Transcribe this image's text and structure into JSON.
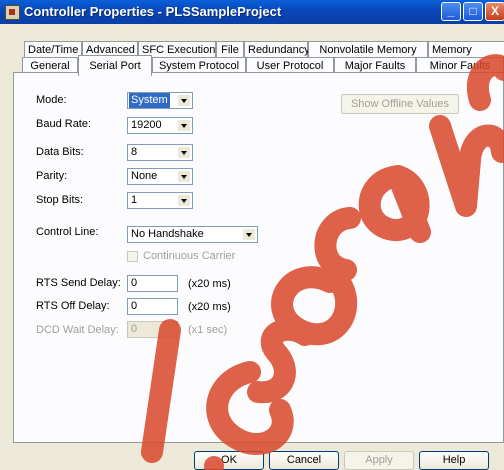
{
  "window": {
    "title": "Controller Properties - PLSSampleProject",
    "controls": {
      "minimize": "_",
      "maximize": "□",
      "close": "X"
    }
  },
  "tabs": {
    "row1": [
      "Date/Time",
      "Advanced",
      "SFC Execution",
      "File",
      "Redundancy",
      "Nonvolatile Memory",
      "Memory"
    ],
    "row2": [
      "General",
      "Serial Port",
      "System Protocol",
      "User Protocol",
      "Major Faults",
      "Minor Faults"
    ],
    "active": "Serial Port"
  },
  "serial_port": {
    "mode": {
      "label": "Mode:",
      "value": "System"
    },
    "baud_rate": {
      "label": "Baud Rate:",
      "value": "19200"
    },
    "data_bits": {
      "label": "Data Bits:",
      "value": "8"
    },
    "parity": {
      "label": "Parity:",
      "value": "None"
    },
    "stop_bits": {
      "label": "Stop Bits:",
      "value": "1"
    },
    "control_line": {
      "label": "Control Line:",
      "value": "No Handshake"
    },
    "continuous_carrier": {
      "label": "Continuous Carrier",
      "checked": false,
      "enabled": false
    },
    "rts_send_delay": {
      "label": "RTS Send Delay:",
      "value": "0",
      "unit": "(x20 ms)"
    },
    "rts_off_delay": {
      "label": "RTS Off Delay:",
      "value": "0",
      "unit": "(x20 ms)"
    },
    "dcd_wait_delay": {
      "label": "DCD Wait Delay:",
      "value": "0",
      "unit": "(x1 sec)",
      "enabled": false
    },
    "show_offline_values": "Show Offline Values"
  },
  "buttons": {
    "ok": "OK",
    "cancel": "Cancel",
    "apply": "Apply",
    "help": "Help"
  },
  "colors": {
    "title_bar": "#0a4fc4",
    "dialog_bg": "#ece9d8",
    "panel_bg": "#fcfcfe",
    "selection": "#316ac5",
    "watermark": "#d9472b"
  }
}
